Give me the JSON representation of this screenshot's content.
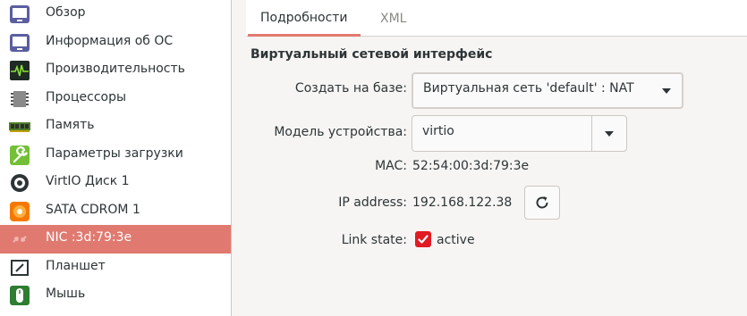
{
  "sidebar": {
    "items": [
      {
        "label": "Обзор",
        "icon": "overview-monitor-icon"
      },
      {
        "label": "Информация об ОС",
        "icon": "os-monitor-icon"
      },
      {
        "label": "Производительность",
        "icon": "performance-graph-icon"
      },
      {
        "label": "Процессоры",
        "icon": "cpu-chip-icon"
      },
      {
        "label": "Память",
        "icon": "memory-module-icon"
      },
      {
        "label": "Параметры загрузки",
        "icon": "boot-wrench-icon"
      },
      {
        "label": "VirtIO Диск 1",
        "icon": "disk-icon"
      },
      {
        "label": "SATA CDROM 1",
        "icon": "cdrom-icon"
      },
      {
        "label": "NIC :3d:79:3e",
        "icon": "network-nic-icon",
        "selected": true
      },
      {
        "label": "Планшет",
        "icon": "tablet-icon"
      },
      {
        "label": "Мышь",
        "icon": "mouse-icon"
      }
    ]
  },
  "tabs": {
    "details": "Подробности",
    "xml": "XML"
  },
  "section": {
    "title": "Виртуальный сетевой интерфейс"
  },
  "form": {
    "source_label": "Создать на базе:",
    "source_value": "Виртуальная сеть 'default' : NAT",
    "model_label": "Модель устройства:",
    "model_value": "virtio",
    "mac_label": "MAC:",
    "mac_value": "52:54:00:3d:79:3e",
    "ip_label": "IP address:",
    "ip_value": "192.168.122.38",
    "link_label": "Link state:",
    "link_value": "active",
    "link_checked": true
  },
  "colors": {
    "accent": "#e07a70",
    "checkbox": "#e01b24"
  }
}
